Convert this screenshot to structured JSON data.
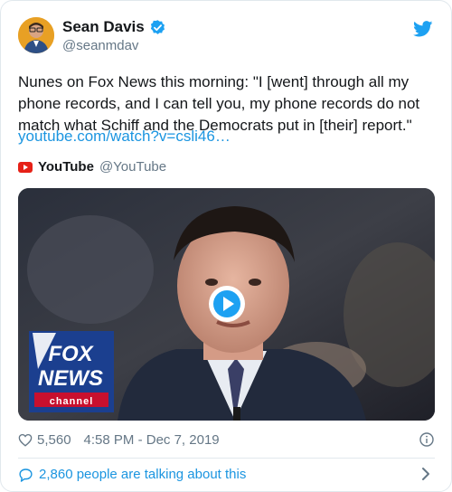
{
  "author": {
    "name": "Sean Davis",
    "handle": "@seanmdav"
  },
  "tweet": {
    "text": "Nunes on Fox News this morning: \"I [went] through all my phone records, and I can tell you, my phone records do not match what Schiff and the Democrats put in [their] report.\"",
    "link": "youtube.com/watch?v=csli46…"
  },
  "source": {
    "name": "YouTube",
    "handle": "@YouTube"
  },
  "media": {
    "logo_lines": [
      "FOX",
      "NEWS"
    ],
    "logo_channel": "channel"
  },
  "stats": {
    "likes": "5,560",
    "timestamp": "4:58 PM - Dec 7, 2019"
  },
  "footer": {
    "talking": "2,860 people are talking about this"
  },
  "colors": {
    "accent": "#1da1f2",
    "link": "#1b95e0",
    "muted": "#657786",
    "fox_blue": "#1b3f8f",
    "fox_red": "#c8102e"
  }
}
